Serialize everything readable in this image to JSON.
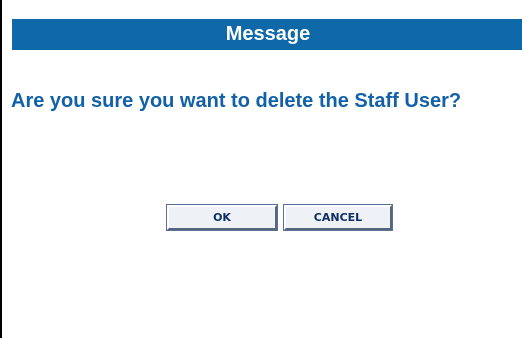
{
  "dialog": {
    "title": "Message",
    "message": "Are you sure you want to delete the Staff User?",
    "ok_label": "OK",
    "cancel_label": "CANCEL"
  },
  "colors": {
    "title_background": "#0f68a8",
    "message_text": "#1261a8",
    "button_text": "#0f2e66"
  }
}
